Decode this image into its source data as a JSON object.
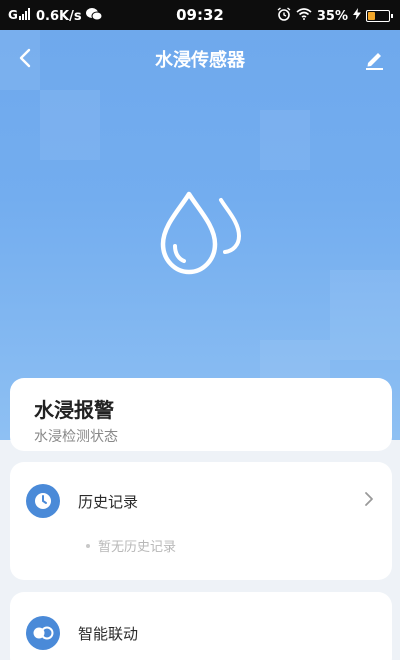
{
  "status_bar": {
    "network_speed": "0.6K/s",
    "time": "09:32",
    "battery_percent": "35%",
    "battery_level": 0.35
  },
  "header": {
    "title": "水浸传感器"
  },
  "alarm_card": {
    "title": "水浸报警",
    "subtitle": "水浸检测状态"
  },
  "history_card": {
    "label": "历史记录",
    "empty_text": "暂无历史记录"
  },
  "linkage_card": {
    "label": "智能联动"
  },
  "colors": {
    "accent": "#4a8ad8",
    "hero_top": "#6ea8ec",
    "hero_bottom": "#8ec0f3"
  }
}
